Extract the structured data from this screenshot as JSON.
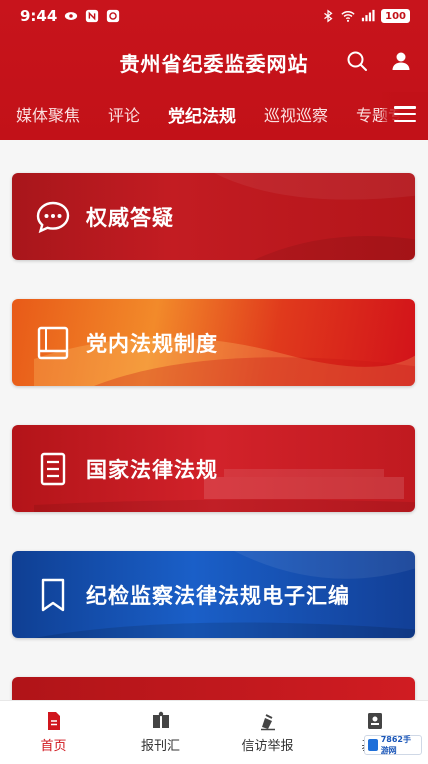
{
  "status": {
    "time": "9:44",
    "battery": "100"
  },
  "header": {
    "title": "贵州省纪委监委网站"
  },
  "tabs": [
    {
      "label": "媒体聚焦"
    },
    {
      "label": "评论"
    },
    {
      "label": "党纪法规",
      "active": true
    },
    {
      "label": "巡视巡察"
    },
    {
      "label": "专题专"
    }
  ],
  "cards": [
    {
      "label": "权威答疑",
      "icon": "chat-bubble-icon"
    },
    {
      "label": "党内法规制度",
      "icon": "book-icon"
    },
    {
      "label": "国家法律法规",
      "icon": "document-icon"
    },
    {
      "label": "纪检监察法律法规电子汇编",
      "icon": "bookmark-icon"
    }
  ],
  "bottom_nav": [
    {
      "label": "首页",
      "icon": "home-doc-icon",
      "active": true
    },
    {
      "label": "报刊汇",
      "icon": "newspaper-icon"
    },
    {
      "label": "信访举报",
      "icon": "report-icon"
    },
    {
      "label": "基层",
      "icon": "profile-icon"
    }
  ],
  "watermark": {
    "text": "7862手游网"
  },
  "colors": {
    "brand_red": "#c21118",
    "active_nav": "#d0161d",
    "blue_card": "#1a5fc8"
  }
}
